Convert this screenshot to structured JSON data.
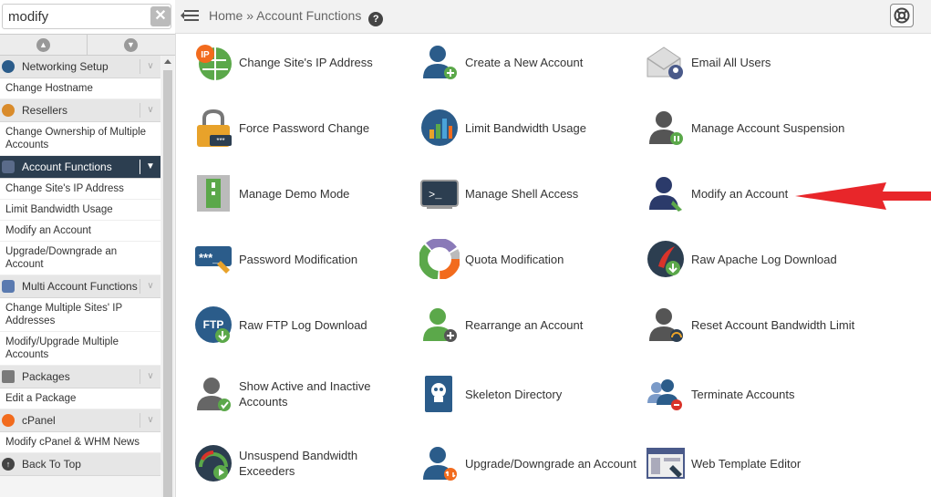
{
  "search": {
    "value": "modify"
  },
  "header": {
    "breadcrumb_home": "Home",
    "breadcrumb_sep": "»",
    "breadcrumb_current": "Account Functions"
  },
  "sidebar": {
    "back_to_top": "Back To Top",
    "categories": [
      {
        "label": "Networking Setup",
        "items": [
          "Change Hostname"
        ]
      },
      {
        "label": "Resellers",
        "items": [
          "Change Ownership of Multiple Accounts"
        ]
      },
      {
        "label": "Account Functions",
        "active": true,
        "items": [
          "Change Site's IP Address",
          "Limit Bandwidth Usage",
          "Modify an Account",
          "Upgrade/Downgrade an Account"
        ]
      },
      {
        "label": "Multi Account Functions",
        "items": [
          "Change Multiple Sites' IP Addresses",
          "Modify/Upgrade Multiple Accounts"
        ]
      },
      {
        "label": "Packages",
        "items": [
          "Edit a Package"
        ]
      },
      {
        "label": "cPanel",
        "items": [
          "Modify cPanel & WHM News"
        ]
      }
    ]
  },
  "functions": [
    {
      "label": "Change Site's IP Address",
      "icon": "ip-address-icon"
    },
    {
      "label": "Create a New Account",
      "icon": "create-account-icon"
    },
    {
      "label": "Email All Users",
      "icon": "email-users-icon"
    },
    {
      "label": "Force Password Change",
      "icon": "lock-icon"
    },
    {
      "label": "Limit Bandwidth Usage",
      "icon": "bandwidth-chart-icon"
    },
    {
      "label": "Manage Account Suspension",
      "icon": "suspension-icon"
    },
    {
      "label": "Manage Demo Mode",
      "icon": "demo-mode-icon"
    },
    {
      "label": "Manage Shell Access",
      "icon": "shell-terminal-icon"
    },
    {
      "label": "Modify an Account",
      "icon": "modify-account-icon"
    },
    {
      "label": "Password Modification",
      "icon": "password-icon"
    },
    {
      "label": "Quota Modification",
      "icon": "quota-pie-icon"
    },
    {
      "label": "Raw Apache Log Download",
      "icon": "apache-log-icon"
    },
    {
      "label": "Raw FTP Log Download",
      "icon": "ftp-log-icon"
    },
    {
      "label": "Rearrange an Account",
      "icon": "rearrange-account-icon"
    },
    {
      "label": "Reset Account Bandwidth Limit",
      "icon": "reset-bandwidth-icon"
    },
    {
      "label": "Show Active and Inactive Accounts",
      "icon": "active-accounts-icon"
    },
    {
      "label": "Skeleton Directory",
      "icon": "skeleton-directory-icon"
    },
    {
      "label": "Terminate Accounts",
      "icon": "terminate-accounts-icon"
    },
    {
      "label": "Unsuspend Bandwidth Exceeders",
      "icon": "unsuspend-bandwidth-icon"
    },
    {
      "label": "Upgrade/Downgrade an Account",
      "icon": "upgrade-downgrade-icon"
    },
    {
      "label": "Web Template Editor",
      "icon": "web-template-icon"
    }
  ],
  "colors": {
    "sidebar_active": "#2c3e50",
    "arrow": "#e8262a",
    "accent_blue": "#2b5c8a",
    "accent_green": "#5ba84a"
  }
}
